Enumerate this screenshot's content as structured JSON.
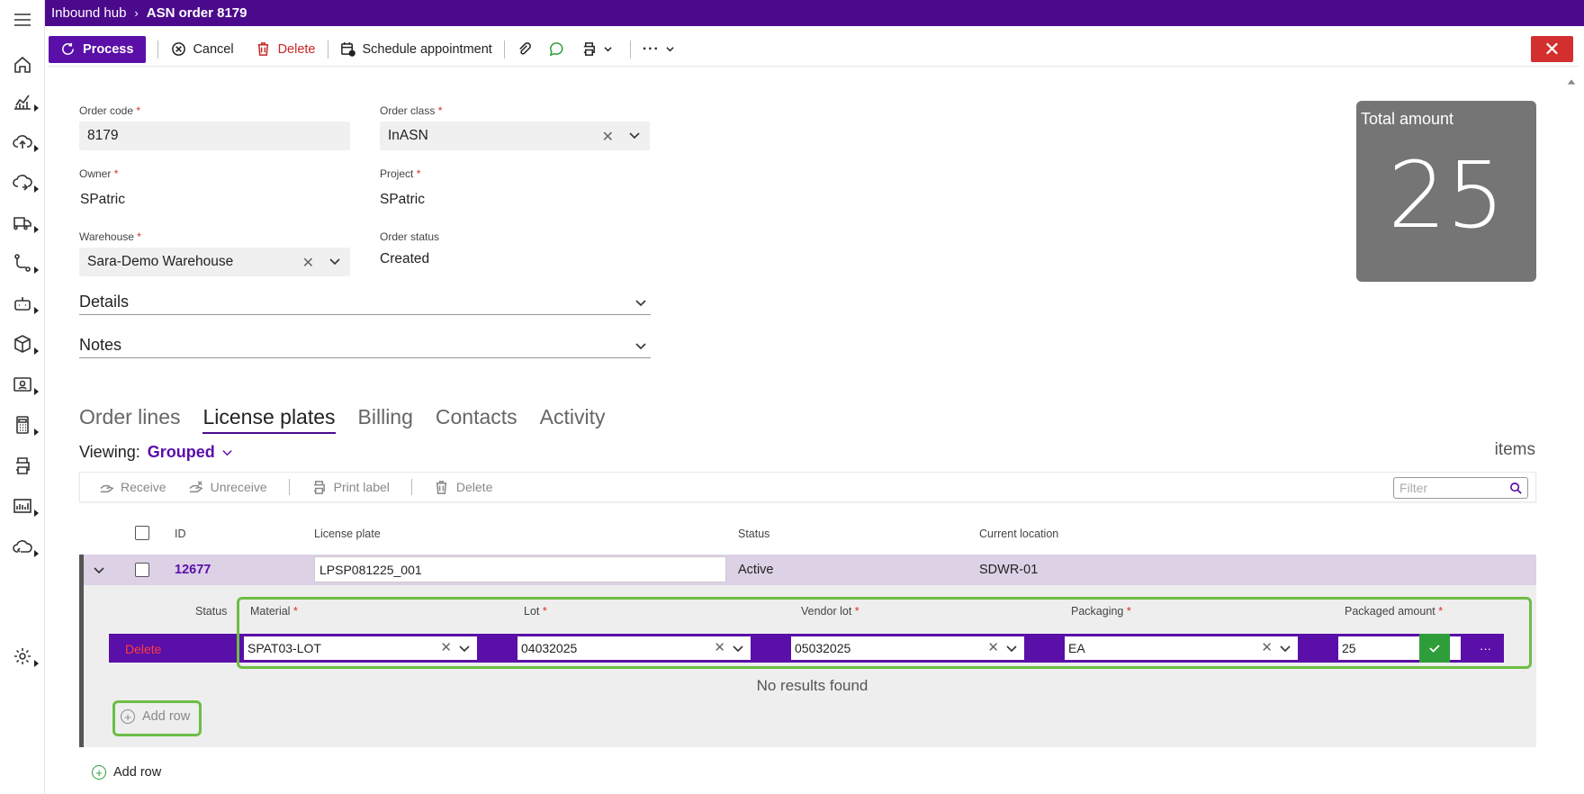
{
  "breadcrumb": {
    "parent": "Inbound hub",
    "separator": "›",
    "current": "ASN order 8179"
  },
  "toolbar": {
    "process": "Process",
    "cancel": "Cancel",
    "delete": "Delete",
    "schedule": "Schedule appointment",
    "close_symbol": "✕"
  },
  "form": {
    "order_code": {
      "label": "Order code",
      "value": "8179"
    },
    "order_class": {
      "label": "Order class",
      "value": "InASN"
    },
    "owner": {
      "label": "Owner",
      "value": "SPatric"
    },
    "project": {
      "label": "Project",
      "value": "SPatric"
    },
    "warehouse": {
      "label": "Warehouse",
      "value": "Sara-Demo Warehouse"
    },
    "order_status": {
      "label": "Order status",
      "value": "Created"
    },
    "required_mark": "*"
  },
  "sections": {
    "details": "Details",
    "notes": "Notes"
  },
  "total": {
    "label": "Total amount",
    "value": "25"
  },
  "tabs": [
    {
      "label": "Order lines",
      "active": false
    },
    {
      "label": "License plates",
      "active": true
    },
    {
      "label": "Billing",
      "active": false
    },
    {
      "label": "Contacts",
      "active": false
    },
    {
      "label": "Activity",
      "active": false
    }
  ],
  "viewing": {
    "label": "Viewing:",
    "value": "Grouped"
  },
  "items_label": "items",
  "actions": {
    "receive": "Receive",
    "unreceive": "Unreceive",
    "print_label": "Print label",
    "delete": "Delete",
    "filter_placeholder": "Filter"
  },
  "grid": {
    "headers": {
      "id": "ID",
      "license_plate": "License plate",
      "status": "Status",
      "current_location": "Current location"
    },
    "row": {
      "id": "12677",
      "license_plate": "LPSP081225_001",
      "status": "Active",
      "current_location": "SDWR-01"
    }
  },
  "subgrid": {
    "headers": {
      "status": "Status",
      "material": "Material",
      "lot": "Lot",
      "vendor_lot": "Vendor lot",
      "packaging": "Packaging",
      "packaged_amount": "Packaged amount"
    },
    "row": {
      "delete": "Delete",
      "material": "SPAT03-LOT",
      "lot": "04032025",
      "vendor_lot": "05032025",
      "packaging": "EA",
      "packaged_amount": "25",
      "more": "···"
    },
    "no_results": "No results found",
    "add_row": "Add row"
  },
  "add_row": "Add row",
  "colors": {
    "brand": "#4b0a8c",
    "accent": "#5a0fa8",
    "danger": "#d32f2f",
    "success": "#2e9e3a",
    "highlight": "#6dbd45"
  }
}
